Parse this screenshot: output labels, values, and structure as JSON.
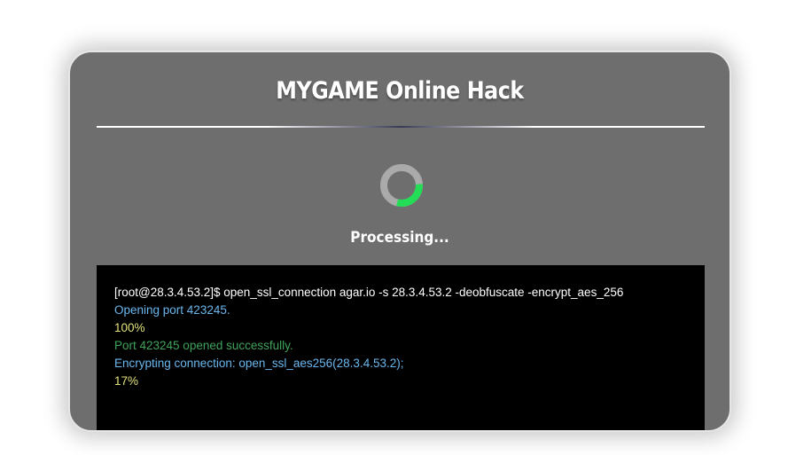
{
  "header": {
    "title": "MYGAME Online Hack"
  },
  "progress": {
    "status": "Processing...",
    "spinner_fraction": 0.3,
    "spinner_color": "#22dd55",
    "track_color": "#aaaaaa"
  },
  "terminal": {
    "lines": [
      {
        "text": "[root@28.3.4.53.2]$ open_ssl_connection agar.io -s 28.3.4.53.2 -deobfuscate -encrypt_aes_256",
        "color": "white"
      },
      {
        "text": "Opening port 423245.",
        "color": "blue"
      },
      {
        "text": "100%",
        "color": "yellow"
      },
      {
        "text": "Port 423245 opened successfully.",
        "color": "green"
      },
      {
        "text": "Encrypting connection: open_ssl_aes256(28.3.4.53.2);",
        "color": "blue"
      },
      {
        "text": "17%",
        "color": "yellow"
      }
    ]
  }
}
